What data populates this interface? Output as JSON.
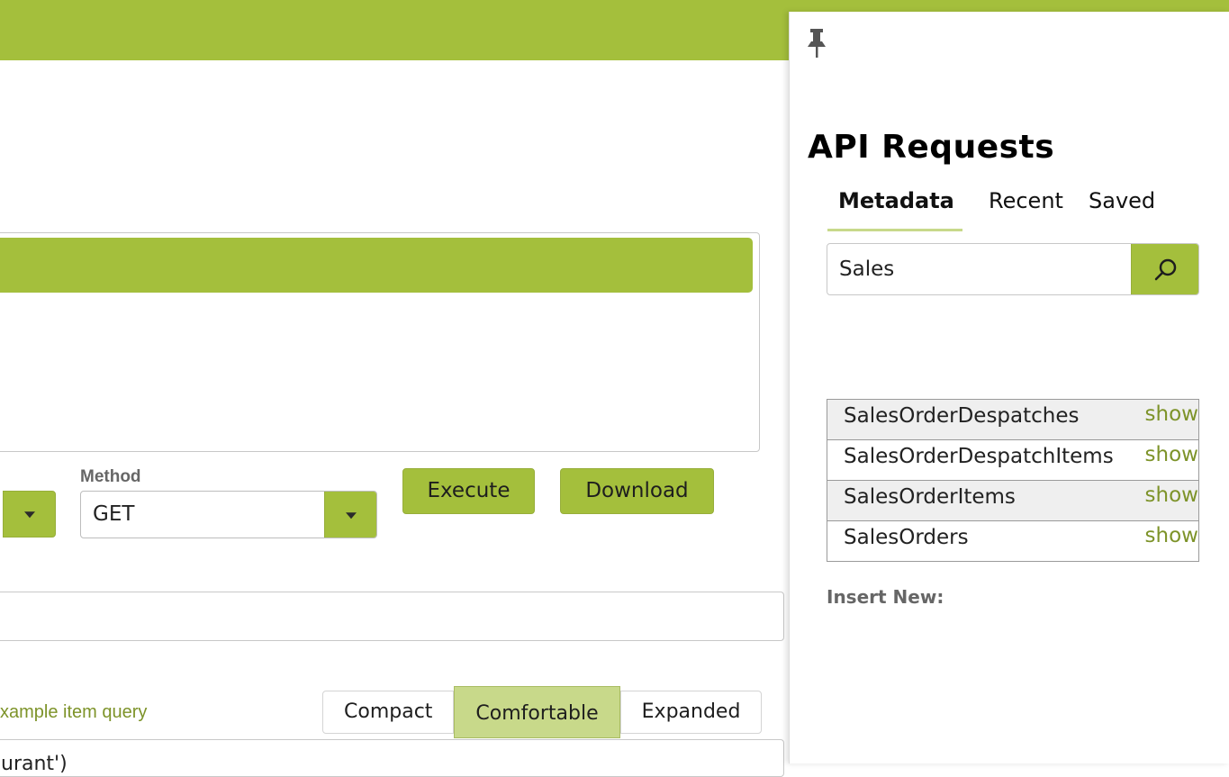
{
  "colors": {
    "accent": "#a4bf3c",
    "accent_light": "#c8d98a",
    "link": "#7d9329"
  },
  "form": {
    "method_label": "Method",
    "method_value": "GET",
    "execute_label": "Execute",
    "download_label": "Download",
    "example_link": "xample item query",
    "query_text": "urant')"
  },
  "density": {
    "options": [
      "Compact",
      "Comfortable",
      "Expanded"
    ],
    "selected": "Comfortable"
  },
  "panel": {
    "title": "API Requests",
    "tabs": [
      {
        "label": "Metadata",
        "active": true
      },
      {
        "label": "Recent",
        "active": false
      },
      {
        "label": "Saved",
        "active": false
      }
    ],
    "search_value": "Sales",
    "results": [
      {
        "name": "SalesOrderDespatches",
        "action": "show"
      },
      {
        "name": "SalesOrderDespatchItems",
        "action": "show"
      },
      {
        "name": "SalesOrderItems",
        "action": "show"
      },
      {
        "name": "SalesOrders",
        "action": "show"
      }
    ],
    "insert_label": "Insert New:"
  },
  "icons": [
    "pin-icon",
    "search-icon",
    "chevron-down-icon"
  ]
}
